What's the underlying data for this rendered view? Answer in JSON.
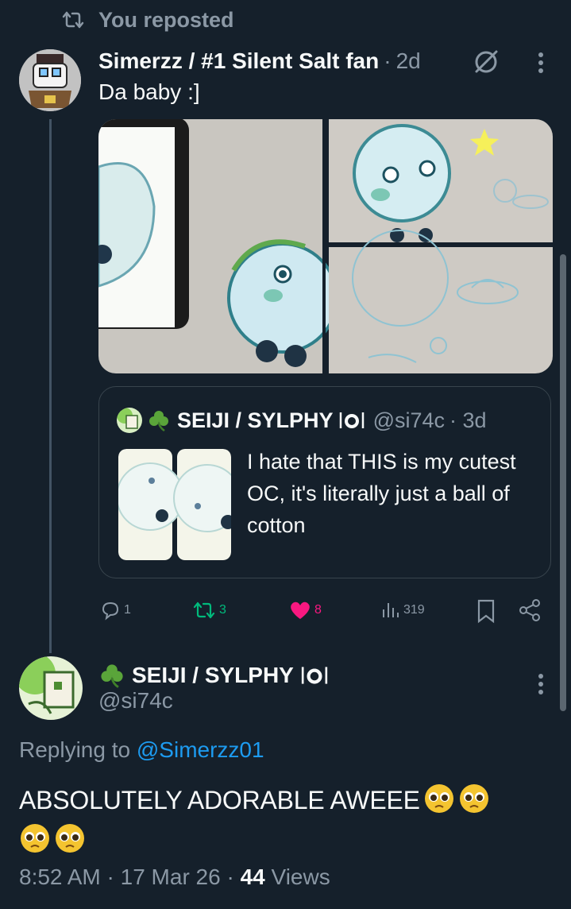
{
  "repost_banner": {
    "text": "You reposted"
  },
  "post": {
    "author_name": "Simerzz / #1 Silent Salt fan",
    "separator": "·",
    "time": "2d",
    "text": "Da baby :]"
  },
  "quote": {
    "author_name": "SEIJI / SYLPHY",
    "handle": "@si74c",
    "time": "· 3d",
    "text": "I hate that THIS is my cutest OC, it's literally just a ball of cotton"
  },
  "actions": {
    "replies": "1",
    "reposts": "3",
    "likes": "8",
    "views": "319"
  },
  "reply": {
    "author_name": "SEIJI / SYLPHY",
    "handle": "@si74c",
    "replying_prefix": "Replying to",
    "replying_to": "@Simerzz01",
    "text": "ABSOLUTELY ADORABLE AWEEE",
    "time": "8:52 AM",
    "date": "17 Mar 26",
    "views_count": "44",
    "views_label": "Views"
  },
  "colors": {
    "background": "#15202b",
    "muted": "#8b98a5",
    "link": "#1d9bf0",
    "repost_green": "#00ba7c",
    "like_pink": "#f91880"
  },
  "icons": [
    "repost-icon",
    "grok-icon",
    "more-icon",
    "reply-icon",
    "heart-icon",
    "views-icon",
    "bookmark-icon",
    "share-icon",
    "shamrock-icon",
    "plate-icon",
    "pleading-face-icon"
  ]
}
